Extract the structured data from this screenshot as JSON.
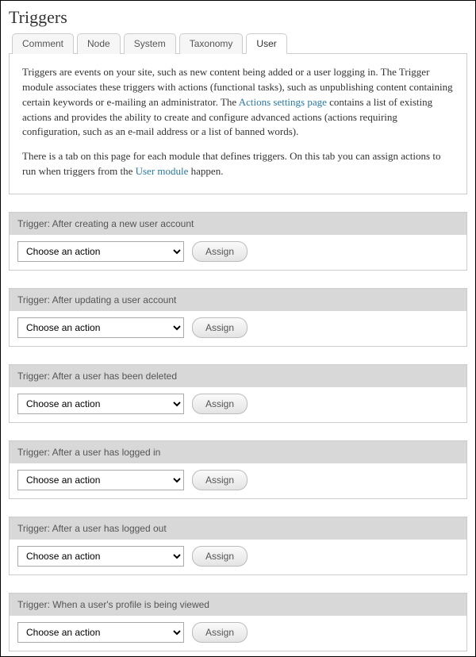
{
  "page": {
    "title": "Triggers"
  },
  "tabs": [
    {
      "label": "Comment",
      "active": false
    },
    {
      "label": "Node",
      "active": false
    },
    {
      "label": "System",
      "active": false
    },
    {
      "label": "Taxonomy",
      "active": false
    },
    {
      "label": "User",
      "active": true
    }
  ],
  "info": {
    "p1_a": "Triggers are events on your site, such as new content being added or a user logging in. The Trigger module associates these triggers with actions (functional tasks), such as unpublishing content containing certain keywords or e-mailing an administrator. The ",
    "p1_link": "Actions settings page",
    "p1_b": " contains a list of existing actions and provides the ability to create and configure advanced actions (actions requiring configuration, such as an e-mail address or a list of banned words).",
    "p2_a": "There is a tab on this page for each module that defines triggers. On this tab you can assign actions to run when triggers from the ",
    "p2_link": "User module",
    "p2_b": " happen."
  },
  "select_placeholder": "Choose an action",
  "assign_label": "Assign",
  "triggers": [
    {
      "title": "Trigger: After creating a new user account"
    },
    {
      "title": "Trigger: After updating a user account"
    },
    {
      "title": "Trigger: After a user has been deleted"
    },
    {
      "title": "Trigger: After a user has logged in"
    },
    {
      "title": "Trigger: After a user has logged out"
    },
    {
      "title": "Trigger: When a user's profile is being viewed"
    }
  ]
}
